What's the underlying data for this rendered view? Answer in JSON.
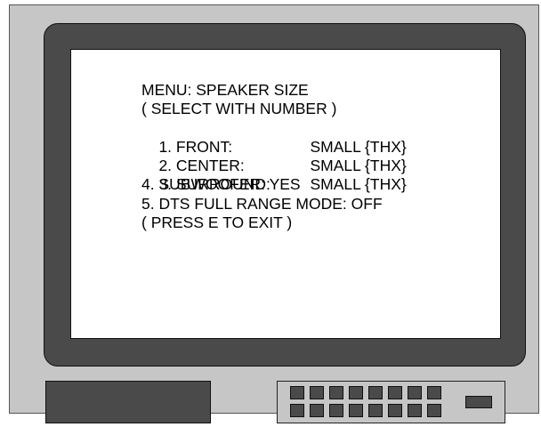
{
  "menu": {
    "title": "MENU: SPEAKER SIZE",
    "instruction": "( SELECT WITH NUMBER )",
    "items": [
      {
        "label": "1. FRONT:",
        "value": "SMALL {THX}"
      },
      {
        "label": "2. CENTER:",
        "value": "SMALL {THX}"
      },
      {
        "label": "3. SURROUND:",
        "value": "SMALL {THX}"
      }
    ],
    "subwoofer": "4. SUBWOOFER: YES",
    "dts_mode": "5. DTS FULL RANGE MODE: OFF",
    "exit_hint": "( PRESS E TO EXIT )"
  },
  "colors": {
    "housing": "#c6c6c6",
    "bezel": "#4a4a4a",
    "screen": "#ffffff",
    "text": "#000000"
  },
  "icons": {
    "buttons": "square-button-icon",
    "wide_button": "rectangle-button-icon"
  }
}
